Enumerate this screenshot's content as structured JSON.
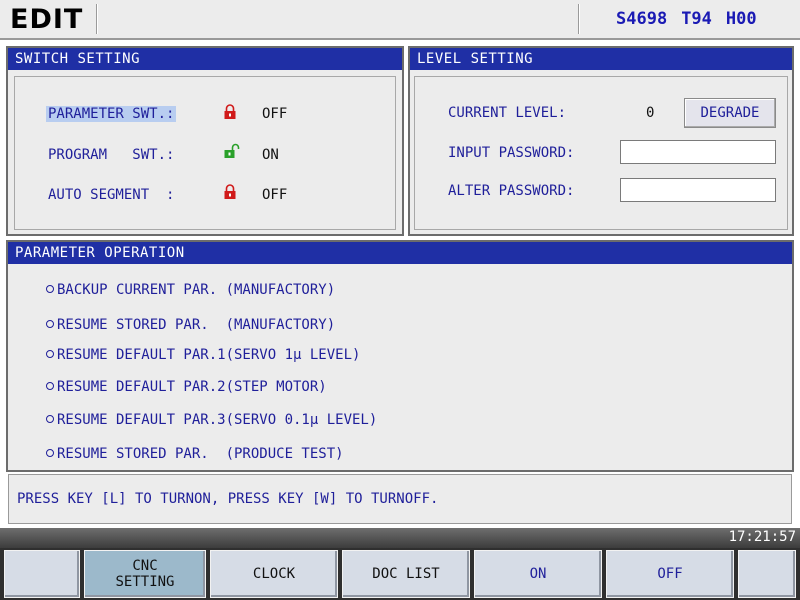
{
  "header": {
    "mode": "EDIT",
    "spindle": "S4698",
    "tool": "T94",
    "h_offset": "H00"
  },
  "switch_setting": {
    "title": "SWITCH SETTING",
    "items": [
      {
        "label": "PARAMETER SWT.:",
        "value": "OFF",
        "icon": "locked-padlock-icon"
      },
      {
        "label": "PROGRAM   SWT.:",
        "value": "ON",
        "icon": "unlocked-padlock-icon"
      },
      {
        "label": "AUTO SEGMENT  :",
        "value": "OFF",
        "icon": "locked-padlock-icon"
      }
    ]
  },
  "level_setting": {
    "title": "LEVEL SETTING",
    "current_level_label": "CURRENT LEVEL:",
    "current_level_value": "0",
    "degrade_label": "DEGRADE",
    "input_password_label": "INPUT PASSWORD:",
    "alter_password_label": "ALTER PASSWORD:",
    "input_password_value": "",
    "alter_password_value": ""
  },
  "parameter_operation": {
    "title": "PARAMETER OPERATION",
    "items": [
      "BACKUP CURRENT PAR. (MANUFACTORY)",
      "RESUME STORED PAR.  (MANUFACTORY)",
      "RESUME DEFAULT PAR.1(SERVO 1μ LEVEL)",
      "RESUME DEFAULT PAR.2(STEP MOTOR)",
      "RESUME DEFAULT PAR.3(SERVO 0.1μ LEVEL)",
      "RESUME STORED PAR.  (PRODUCE TEST)"
    ]
  },
  "hint": "PRESS KEY [L] TO TURNON, PRESS KEY [W] TO TURNOFF.",
  "clock": "17:21:57",
  "softkeys": {
    "blank_left": "",
    "cnc_setting_line1": "CNC",
    "cnc_setting_line2": "SETTING",
    "clock": "CLOCK",
    "doc_list": "DOC LIST",
    "on": "ON",
    "off": "OFF",
    "blank_right": ""
  },
  "colors": {
    "title_bar": "#1f2fa5",
    "label_blue": "#1f1f9a",
    "lock_red": "#d01a1a",
    "unlock_green": "#2aa02a"
  }
}
